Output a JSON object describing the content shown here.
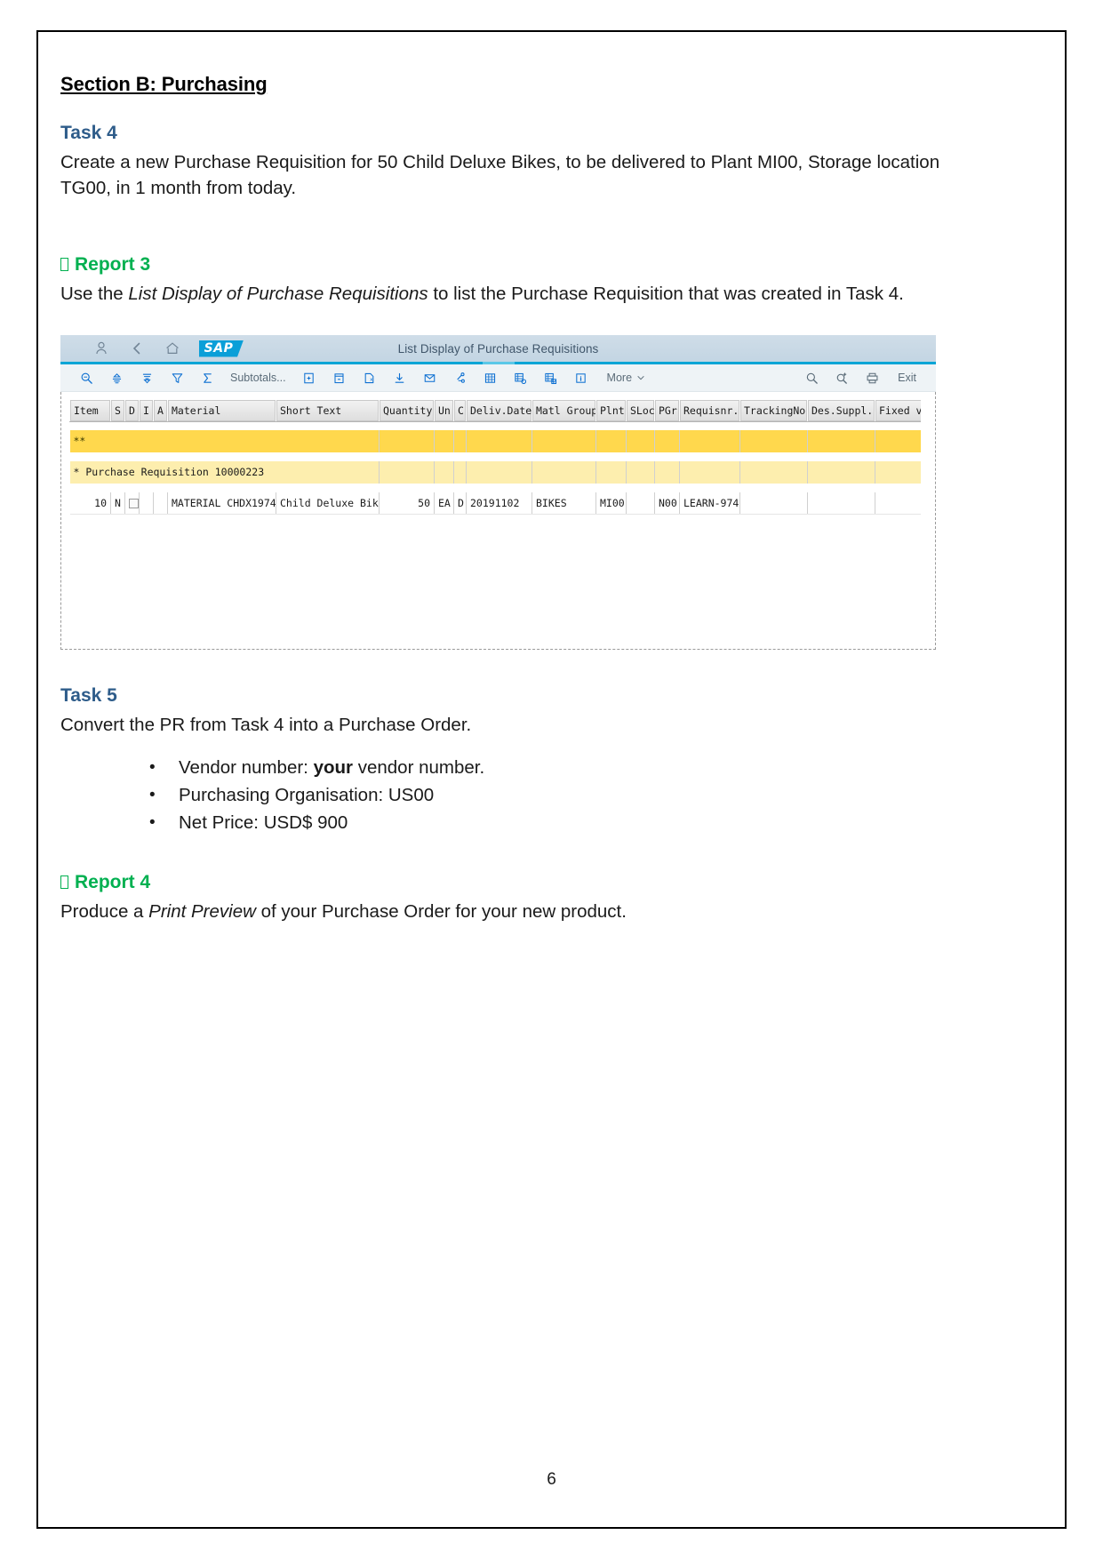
{
  "document": {
    "section_heading": "Section B: Purchasing",
    "page_number": "6",
    "task4": {
      "heading": "Task 4",
      "body": "Create a new Purchase Requisition for 50 Child Deluxe Bikes, to be delivered to Plant MI00, Storage location TG00, in 1 month from today."
    },
    "report3": {
      "heading": "Report 3",
      "body_prefix": "Use the ",
      "body_italic": "List Display of Purchase Requisitions",
      "body_suffix": " to list the Purchase Requisition that was created in Task 4."
    },
    "task5": {
      "heading": "Task 5",
      "body": "Convert the PR from Task 4 into a Purchase Order.",
      "bullets": [
        {
          "prefix": "Vendor number: ",
          "bold": "your",
          "suffix": " vendor number."
        },
        {
          "prefix": "Purchasing Organisation: US00",
          "bold": "",
          "suffix": ""
        },
        {
          "prefix": "Net Price: USD$ 900",
          "bold": "",
          "suffix": ""
        }
      ]
    },
    "report4": {
      "heading": "Report 4",
      "body_prefix": "Produce a ",
      "body_italic": "Print Preview",
      "body_suffix": " of your Purchase Order for your new product."
    }
  },
  "sap": {
    "header": {
      "title": "List Display of Purchase Requisitions",
      "logo": "SAP",
      "icons": [
        "user-icon",
        "back-icon",
        "home-icon"
      ]
    },
    "toolbar": {
      "left_icons": [
        "find-icon",
        "sort-ascending-icon",
        "sort-descending-icon",
        "filter-icon",
        "sum-icon"
      ],
      "subtotals_label": "Subtotals...",
      "mid_icons": [
        "print-preview-icon",
        "export-icon",
        "spreadsheet-icon",
        "download-icon",
        "mail-icon",
        "link-icon",
        "grid-icon",
        "grid-settings-icon",
        "grid-select-icon",
        "info-icon"
      ],
      "more_label": "More",
      "right_icons": [
        "search-icon",
        "search-plus-icon",
        "print-icon"
      ],
      "exit_label": "Exit"
    },
    "grid": {
      "columns": [
        "Item",
        "S",
        "D",
        "I",
        "A",
        "Material",
        "Short Text",
        "Quantity",
        "Un",
        "C",
        "Deliv.Date",
        "Matl Group",
        "Plnt",
        "SLoc",
        "PGr",
        "Requisnr.",
        "TrackingNo",
        "Des.Suppl.",
        "Fixed vend"
      ],
      "total_row_marker": "**",
      "subtotal_row_label": "* Purchase Requisition 10000223",
      "rows": [
        {
          "item": "10",
          "s": "N",
          "d": "checkbox",
          "i": "",
          "a": "",
          "material": "MATERIAL CHDX1974",
          "short_text": "Child Deluxe Bike",
          "quantity": "50",
          "un": "EA",
          "c": "D",
          "deliv_date": "20191102",
          "matl_group": "BIKES",
          "plnt": "MI00",
          "sloc": "",
          "pgr": "N00",
          "requisnr": "LEARN-974",
          "tracking_no": "",
          "des_suppl": "",
          "fixed_vend": ""
        }
      ]
    }
  }
}
